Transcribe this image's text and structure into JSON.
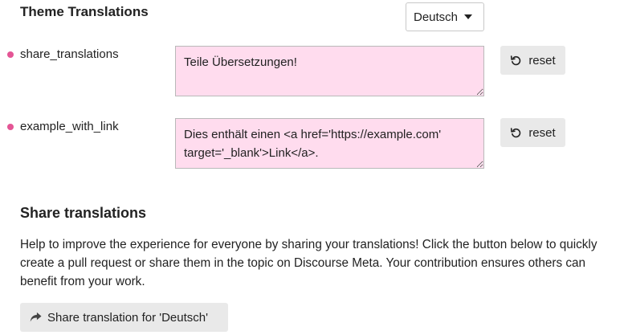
{
  "header": {
    "title": "Theme Translations",
    "language_select": {
      "selected": "Deutsch",
      "icon": "caret-down-icon"
    }
  },
  "colors": {
    "bullet": "#e45595",
    "textarea_bg": "#ffdcee",
    "button_bg": "#e9e9e9"
  },
  "translations": [
    {
      "key": "share_translations",
      "value": "Teile Übersetzungen!",
      "reset_label": "reset",
      "reset_icon": "undo-icon"
    },
    {
      "key": "example_with_link",
      "value": "Dies enthält einen <a href='https://example.com' target='_blank'>Link</a>.",
      "reset_label": "reset",
      "reset_icon": "undo-icon"
    }
  ],
  "share": {
    "title": "Share translations",
    "description": "Help to improve the experience for everyone by sharing your translations! Click the button below to quickly create a pull request or share them in the topic on Discourse Meta. Your contribution ensures others can benefit from your work.",
    "button_label": "Share translation for 'Deutsch'",
    "button_icon": "share-arrow-icon"
  }
}
